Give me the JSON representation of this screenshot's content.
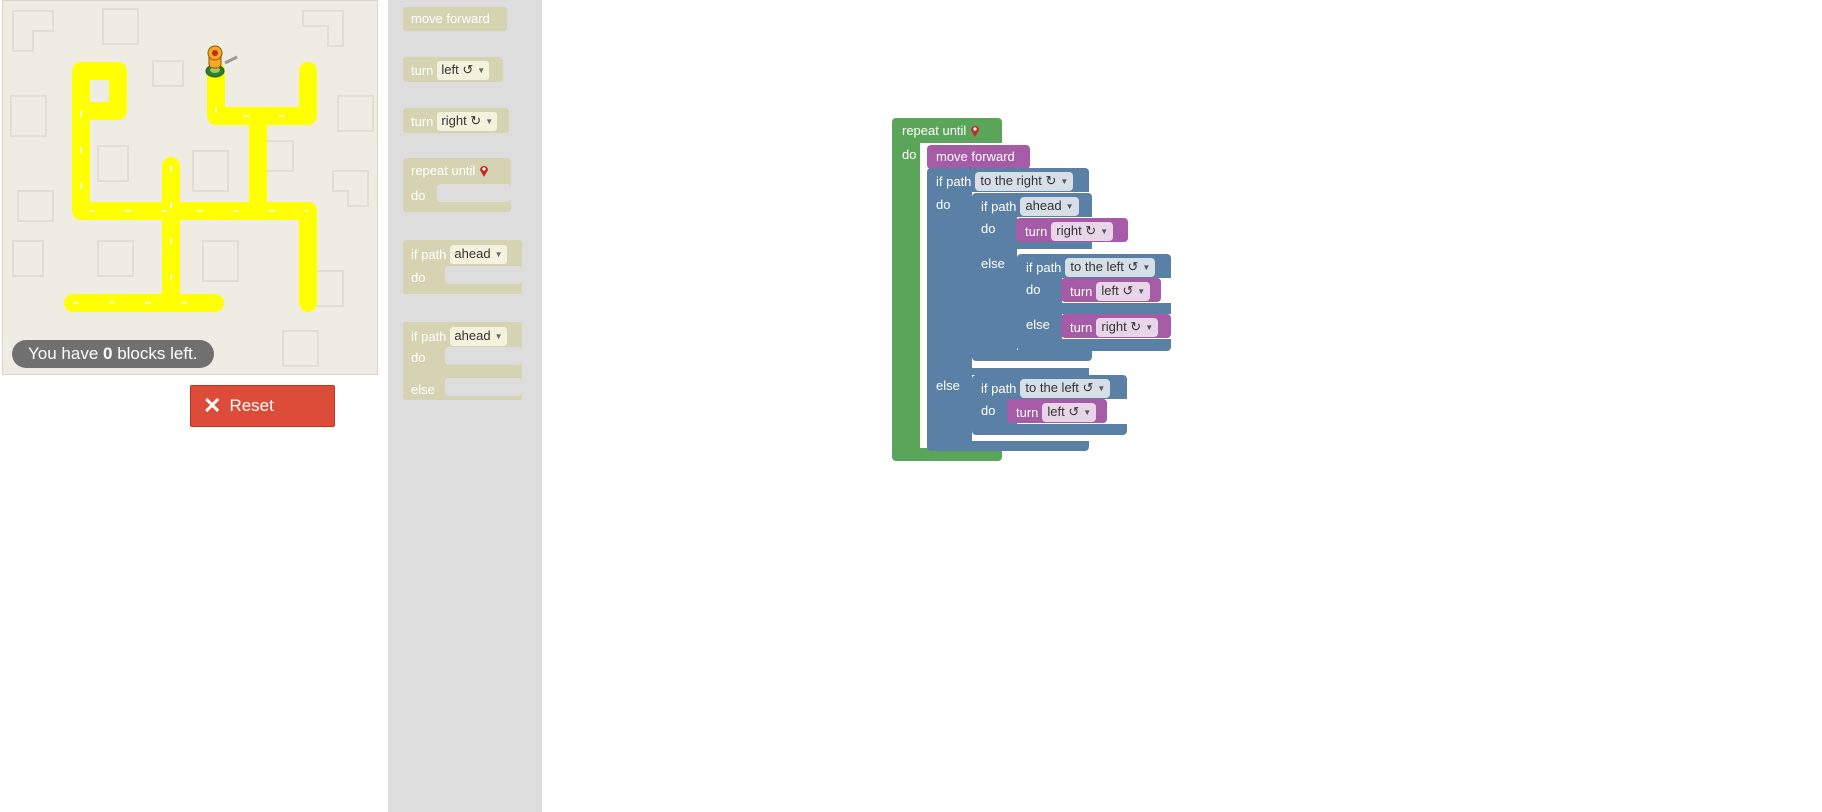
{
  "maze": {
    "status_prefix": "You have ",
    "blocks_left": "0",
    "status_suffix": " blocks left.",
    "reset_label": "Reset",
    "path_color": "#ffff00",
    "player_icon": "pegman-icon"
  },
  "toolbox": {
    "move_forward": "move forward",
    "turn_left": {
      "label": "turn",
      "value": "left ↺"
    },
    "turn_right": {
      "label": "turn",
      "value": "right ↻"
    },
    "repeat_until": {
      "label": "repeat until",
      "do": "do"
    },
    "if_path": {
      "label": "if path",
      "value": "ahead",
      "do": "do"
    },
    "if_else": {
      "label": "if path",
      "value": "ahead",
      "do": "do",
      "else": "else"
    }
  },
  "workspace": {
    "repeat_until": "repeat until",
    "do": "do",
    "else": "else",
    "move_forward": "move forward",
    "if_path": "if path",
    "turn": "turn",
    "dir_to_the_right": "to the right ↻",
    "dir_ahead": "ahead",
    "dir_to_the_left": "to the left ↺",
    "right": "right ↻",
    "left": "left ↺"
  },
  "colors": {
    "loop_block": "#5ba55b",
    "logic_block": "#5b80a5",
    "movement_block": "#a55ba5",
    "toolbox_disabled_block": "#d6d3b2",
    "reset_button": "#dd4b39"
  }
}
